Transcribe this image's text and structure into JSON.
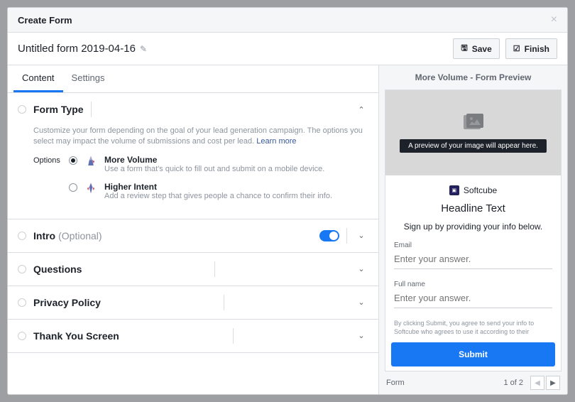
{
  "header": {
    "title": "Create Form"
  },
  "toolbar": {
    "form_name": "Untitled form 2019-04-16",
    "save": "Save",
    "finish": "Finish"
  },
  "tabs": {
    "content": "Content",
    "settings": "Settings"
  },
  "formType": {
    "title": "Form Type",
    "desc": "Customize your form depending on the goal of your lead generation campaign. The options you select may impact the volume of submissions and cost per lead. ",
    "learn": "Learn more",
    "optionsLabel": "Options",
    "moreVolume": {
      "title": "More Volume",
      "desc": "Use a form that's quick to fill out and submit on a mobile device."
    },
    "higherIntent": {
      "title": "Higher Intent",
      "desc": "Add a review step that gives people a chance to confirm their info."
    }
  },
  "sections": {
    "intro": "Intro",
    "intro_optional": "(Optional)",
    "questions": "Questions",
    "privacy": "Privacy Policy",
    "thankyou": "Thank You Screen"
  },
  "preview": {
    "title": "More Volume - Form Preview",
    "banner": "A preview of your image will appear here.",
    "brand": "Softcube",
    "headline": "Headline Text",
    "subline": "Sign up by providing your info below.",
    "email_label": "Email",
    "email_ph": "Enter your answer.",
    "name_label": "Full name",
    "name_ph": "Enter your answer.",
    "consent": "By clicking Submit, you agree to send your info to Softcube who agrees to use it according to their",
    "submit": "Submit"
  },
  "pager": {
    "label": "Form",
    "pos": "1 of 2"
  }
}
